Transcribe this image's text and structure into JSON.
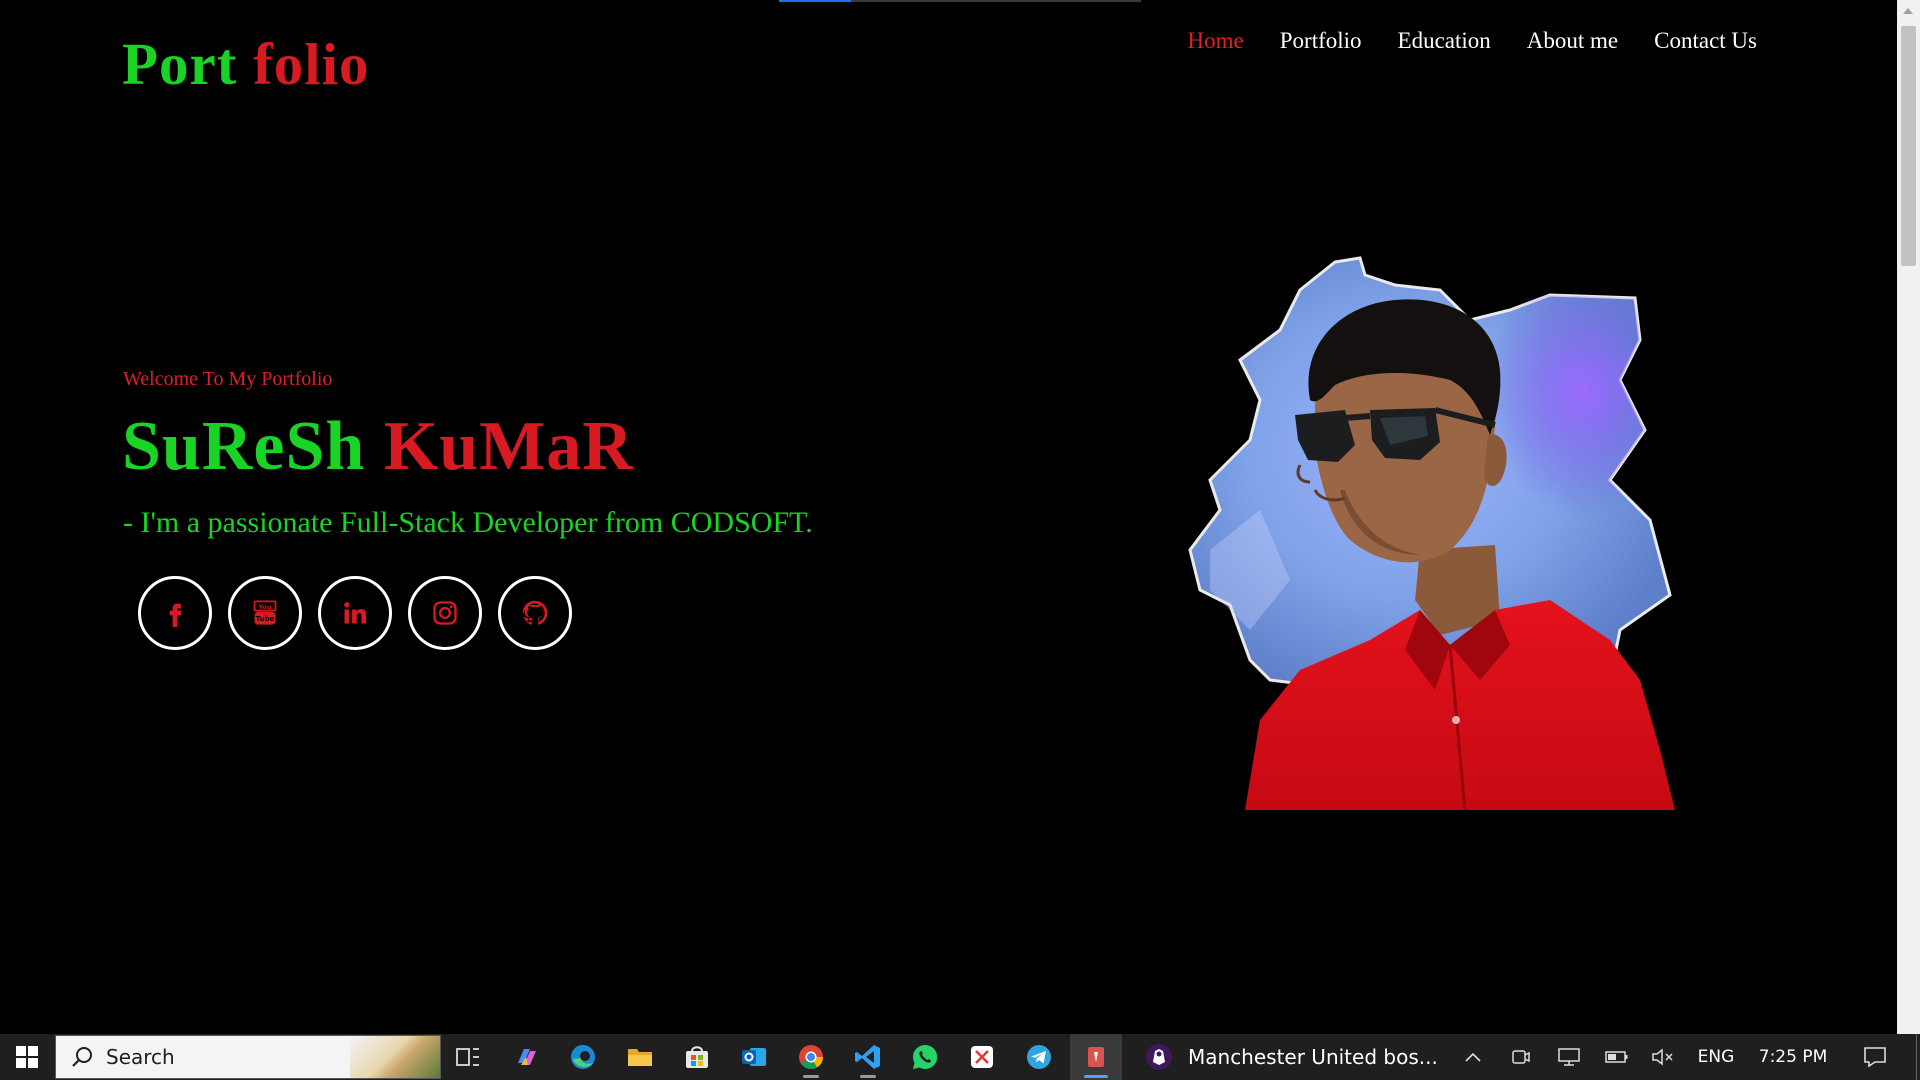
{
  "header": {
    "logo_part1": "Port",
    "logo_part2": "folio",
    "nav": [
      "Home",
      "Portfolio",
      "Education",
      "About me",
      "Contact Us"
    ],
    "active_nav": "Home"
  },
  "hero": {
    "welcome": "Welcome To My Portfolio",
    "name_first": "SuReSh",
    "name_last": "KuMaR",
    "tagline": "- I'm a passionate Full-Stack Developer from CODSOFT.",
    "social_icons": [
      "facebook-icon",
      "youtube-icon",
      "linkedin-icon",
      "instagram-icon",
      "github-icon"
    ]
  },
  "colors": {
    "green": "#19d325",
    "red": "#d81b22",
    "background": "#000000"
  },
  "taskbar": {
    "search_placeholder": "Search",
    "news_text": "Manchester United bos...",
    "language": "ENG",
    "time": "7:25 PM",
    "apps": [
      "task-view-icon",
      "copilot-icon",
      "edge-icon",
      "file-explorer-icon",
      "store-icon",
      "outlook-icon",
      "chrome-icon",
      "vscode-icon",
      "whatsapp-icon",
      "screenshot-app-icon",
      "telegram-icon",
      "active-app-icon"
    ]
  }
}
